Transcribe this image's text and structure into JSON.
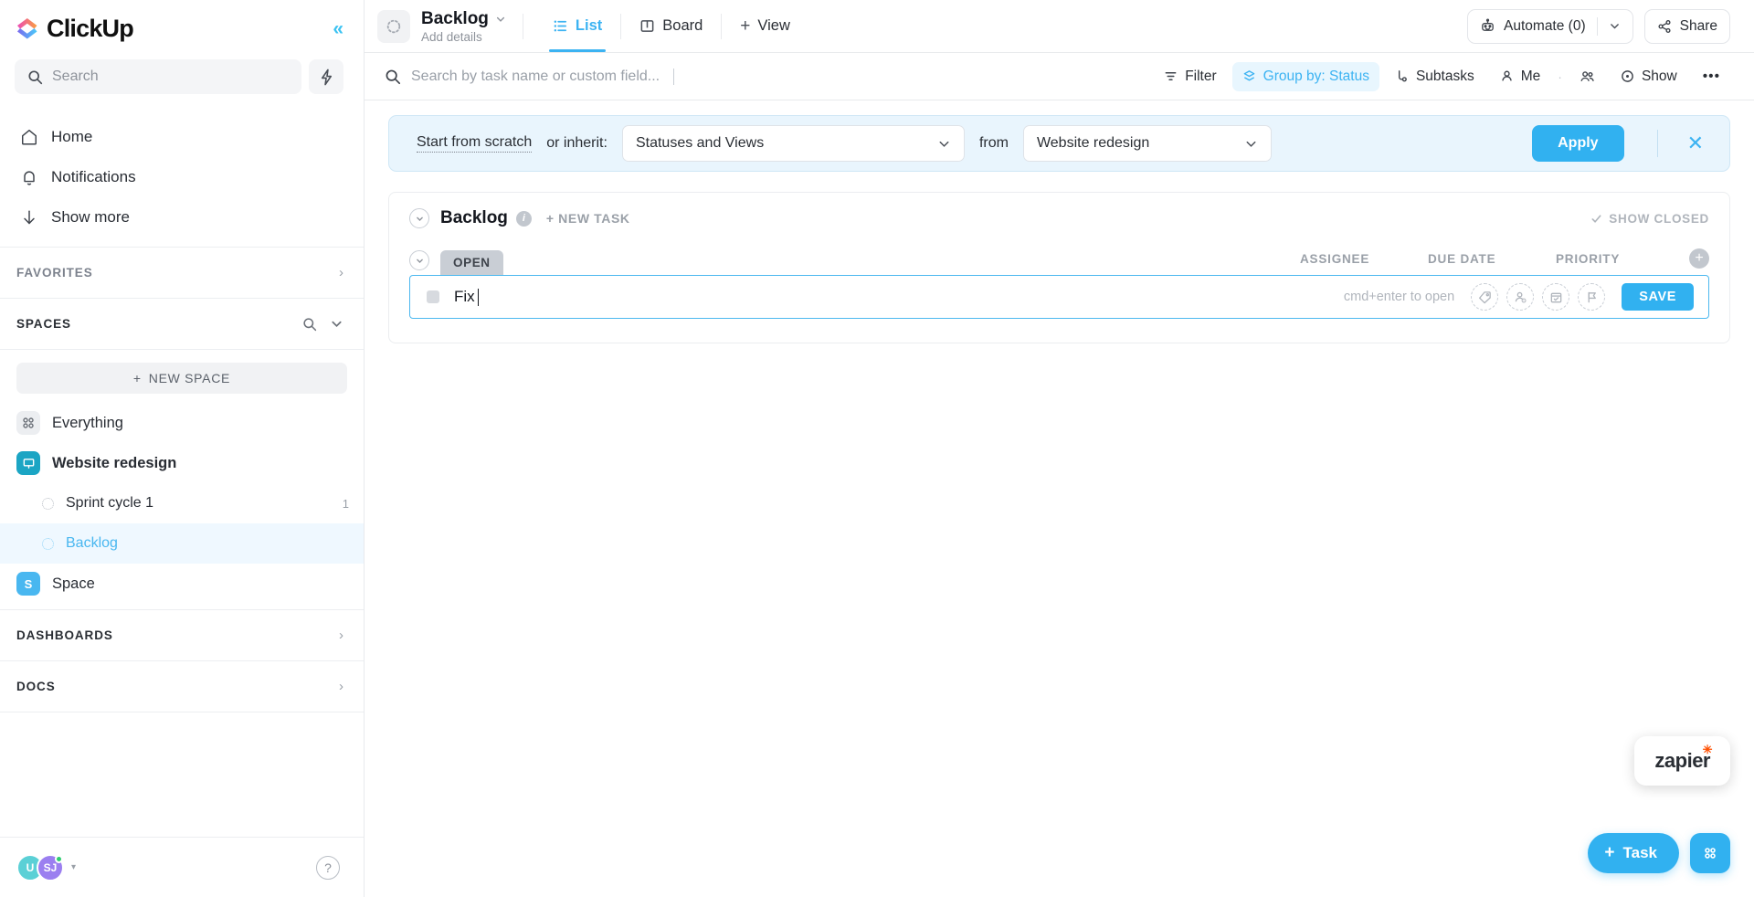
{
  "sidebar": {
    "brand": "ClickUp",
    "collapse_label": "«",
    "search_placeholder": "Search",
    "nav": [
      {
        "label": "Home",
        "icon": "home-icon"
      },
      {
        "label": "Notifications",
        "icon": "bell-icon"
      },
      {
        "label": "Show more",
        "icon": "arrow-down-icon"
      }
    ],
    "favorites_label": "FAVORITES",
    "spaces_label": "SPACES",
    "new_space_label": "NEW SPACE",
    "spaces": [
      {
        "label": "Everything",
        "icon": "grid-icon"
      },
      {
        "label": "Website redesign",
        "icon": "monitor-icon"
      }
    ],
    "lists": [
      {
        "label": "Sprint cycle 1",
        "count": "1",
        "active": false
      },
      {
        "label": "Backlog",
        "count": "",
        "active": true
      }
    ],
    "space_item": {
      "label": "Space",
      "initial": "S"
    },
    "dashboards_label": "DASHBOARDS",
    "docs_label": "DOCS",
    "avatars": [
      {
        "initials": "U"
      },
      {
        "initials": "SJ"
      }
    ],
    "help_label": "?"
  },
  "topbar": {
    "title": "Backlog",
    "subtitle": "Add details",
    "tabs": [
      {
        "label": "List",
        "icon": "list-icon",
        "active": true
      },
      {
        "label": "Board",
        "icon": "board-icon",
        "active": false
      }
    ],
    "add_view_label": "View",
    "automate_label": "Automate (0)",
    "share_label": "Share"
  },
  "toolbar": {
    "search_placeholder": "Search by task name or custom field...",
    "filter_label": "Filter",
    "group_by_label": "Group by: Status",
    "subtasks_label": "Subtasks",
    "me_label": "Me",
    "show_label": "Show",
    "more_label": "•••"
  },
  "inherit_bar": {
    "scratch_link": "Start from scratch",
    "or_inherit_label": "or inherit:",
    "inherit_value": "Statuses and Views",
    "from_label": "from",
    "from_value": "Website redesign",
    "apply_label": "Apply",
    "close_label": "✕"
  },
  "list": {
    "group_name": "Backlog",
    "info_label": "i",
    "new_task_label": "+ NEW TASK",
    "show_closed_label": "SHOW CLOSED",
    "status_label": "OPEN",
    "columns": [
      "ASSIGNEE",
      "DUE DATE",
      "PRIORITY"
    ],
    "add_column_label": "+",
    "task_draft": {
      "text": "Fix",
      "hint": "cmd+enter to open",
      "save_label": "SAVE",
      "quick_icons": [
        "tag-icon",
        "assignee-icon",
        "calendar-icon",
        "flag-icon"
      ]
    }
  },
  "floating": {
    "zapier_label": "zapier",
    "fab_task_label": "Task"
  },
  "colors": {
    "accent": "#31b1f0",
    "accent_light": "#e8f6fe",
    "banner_bg": "#e9f5fd",
    "space_teal": "#1ba5c4",
    "space_blue": "#49b7f0"
  }
}
